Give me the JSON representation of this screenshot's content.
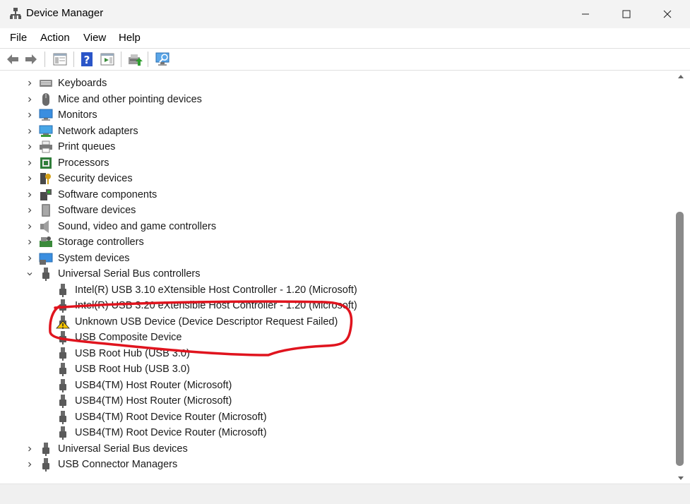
{
  "window": {
    "title": "Device Manager"
  },
  "menu": [
    "File",
    "Action",
    "View",
    "Help"
  ],
  "tree": {
    "categories_top": [
      {
        "label": "Keyboards",
        "icon": "keyboard-icon"
      },
      {
        "label": "Mice and other pointing devices",
        "icon": "mouse-icon"
      },
      {
        "label": "Monitors",
        "icon": "monitor-icon"
      },
      {
        "label": "Network adapters",
        "icon": "network-adapter-icon"
      },
      {
        "label": "Print queues",
        "icon": "printer-icon"
      },
      {
        "label": "Processors",
        "icon": "processor-icon"
      },
      {
        "label": "Security devices",
        "icon": "security-device-icon"
      },
      {
        "label": "Software components",
        "icon": "software-component-icon"
      },
      {
        "label": "Software devices",
        "icon": "software-device-icon"
      },
      {
        "label": "Sound, video and game controllers",
        "icon": "speaker-icon"
      },
      {
        "label": "Storage controllers",
        "icon": "storage-controller-icon"
      },
      {
        "label": "System devices",
        "icon": "system-device-icon"
      }
    ],
    "usb_controllers": {
      "label": "Universal Serial Bus controllers",
      "children": [
        {
          "label": "Intel(R) USB 3.10 eXtensible Host Controller - 1.20 (Microsoft)",
          "warning": false
        },
        {
          "label": "Intel(R) USB 3.20 eXtensible Host Controller - 1.20 (Microsoft)",
          "warning": false
        },
        {
          "label": "Unknown USB Device (Device Descriptor Request Failed)",
          "warning": true
        },
        {
          "label": "USB Composite Device",
          "warning": false
        },
        {
          "label": "USB Root Hub (USB 3.0)",
          "warning": false
        },
        {
          "label": "USB Root Hub (USB 3.0)",
          "warning": false
        },
        {
          "label": "USB4(TM) Host Router (Microsoft)",
          "warning": false
        },
        {
          "label": "USB4(TM) Host Router (Microsoft)",
          "warning": false
        },
        {
          "label": "USB4(TM) Root Device Router (Microsoft)",
          "warning": false
        },
        {
          "label": "USB4(TM) Root Device Router (Microsoft)",
          "warning": false
        }
      ]
    },
    "categories_bottom": [
      {
        "label": "Universal Serial Bus devices",
        "icon": "usb-plug-icon"
      },
      {
        "label": "USB Connector Managers",
        "icon": "usb-plug-icon"
      }
    ]
  },
  "colors": {
    "annotation": "#e0141e",
    "warning": "#f5c400",
    "scroll_thumb": "#8a8a8a"
  }
}
